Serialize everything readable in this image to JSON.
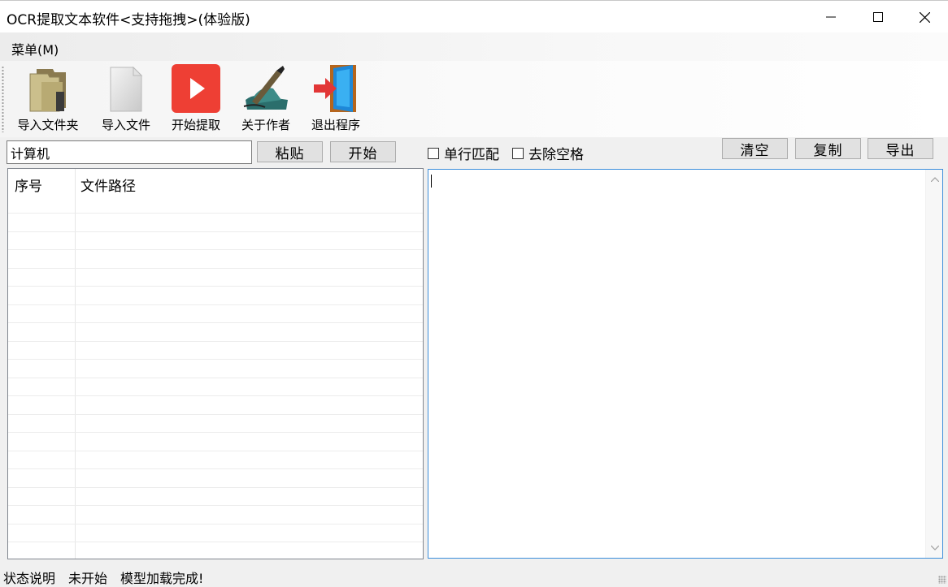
{
  "window": {
    "title": "OCR提取文本软件<支持拖拽>(体验版)",
    "minimize_icon": "minimize-icon",
    "maximize_icon": "maximize-icon",
    "close_icon": "close-icon"
  },
  "menu": {
    "items": [
      {
        "label": "菜单(M)"
      }
    ]
  },
  "toolbar": {
    "buttons": [
      {
        "label": "导入文件夹",
        "icon": "folder-icon"
      },
      {
        "label": "导入文件",
        "icon": "file-icon"
      },
      {
        "label": "开始提取",
        "icon": "play-icon"
      },
      {
        "label": "关于作者",
        "icon": "pen-writing-icon"
      },
      {
        "label": "退出程序",
        "icon": "exit-door-icon"
      }
    ]
  },
  "controls": {
    "input_value": "计算机",
    "paste_label": "粘贴",
    "start_label": "开始",
    "checkbox_single_line": "单行匹配",
    "checkbox_remove_spaces": "去除空格",
    "clear_label": "清空",
    "copy_label": "复制",
    "export_label": "导出"
  },
  "file_list": {
    "columns": [
      "序号",
      "文件路径"
    ],
    "rows": []
  },
  "output_text": "",
  "status": {
    "label": "状态说明",
    "state": "未开始",
    "message": "模型加载完成!"
  },
  "colors": {
    "play_red": "#ee3f34",
    "focus_border": "#3c8edb",
    "window_bg": "#f0f0f0"
  }
}
